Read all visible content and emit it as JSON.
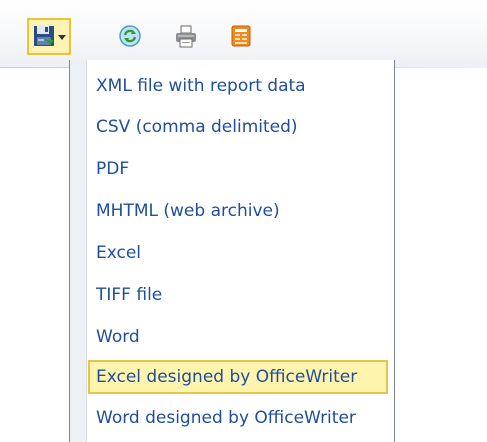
{
  "toolbar": {
    "export_button": {
      "icon": "save-icon",
      "dropdown_icon": "chevron-down-icon"
    },
    "refresh_icon": "refresh-icon",
    "print_icon": "printer-icon",
    "document_map_icon": "document-map-icon"
  },
  "export_menu": {
    "items": [
      {
        "label": "XML file with report data"
      },
      {
        "label": "CSV (comma delimited)"
      },
      {
        "label": "PDF"
      },
      {
        "label": "MHTML (web archive)"
      },
      {
        "label": "Excel"
      },
      {
        "label": "TIFF file"
      },
      {
        "label": "Word"
      },
      {
        "label": "Excel designed by OfficeWriter",
        "highlighted": true
      },
      {
        "label": "Word designed by OfficeWriter"
      }
    ]
  },
  "colors": {
    "menu_text": "#1f4e9a",
    "highlight_bg": "#fff4ad",
    "highlight_border": "#e6c54c",
    "toolbar_button_bg": "#fff3b3"
  }
}
